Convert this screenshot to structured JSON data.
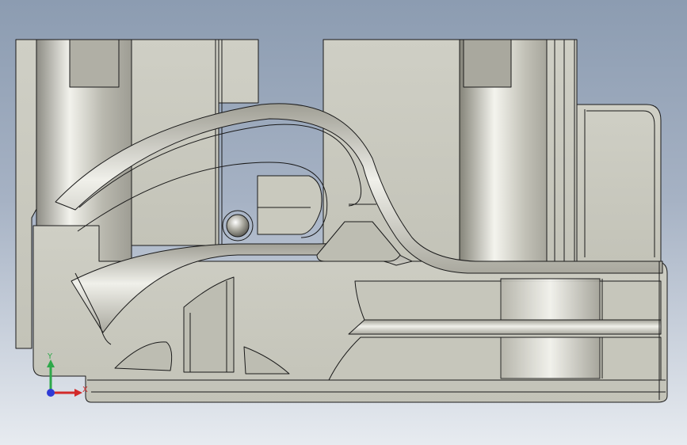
{
  "viewport": {
    "background_top": "#8c9cb1",
    "background_bottom": "#e7ebf0"
  },
  "model": {
    "body_color": "#c8c8bd",
    "edge_color": "#1a1a1a"
  },
  "triad": {
    "y_label": "Y",
    "x_label": "X",
    "y_color": "#2ea84a",
    "x_color": "#d22a2a",
    "z_color": "#2f3bd6"
  }
}
